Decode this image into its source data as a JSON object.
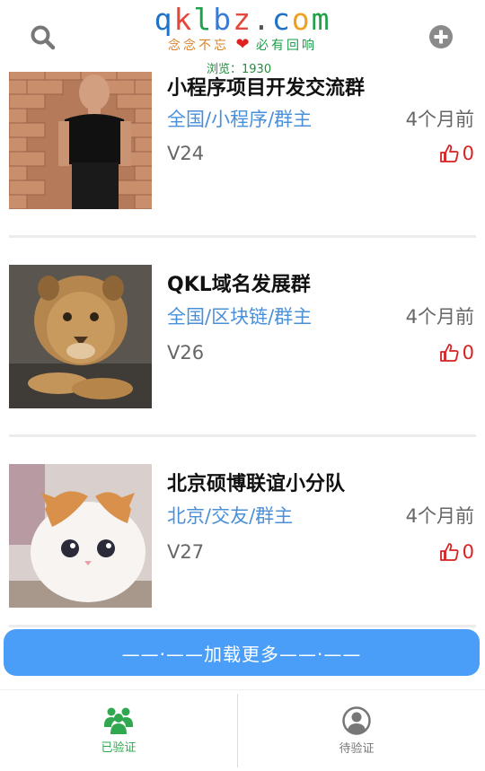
{
  "header": {
    "logo_letters": [
      "q",
      "k",
      "l",
      "b",
      "z",
      ".",
      "c",
      "o",
      "m"
    ],
    "logo_colors": [
      "#1e73c8",
      "#e5483a",
      "#21a04a",
      "#3a7bd5",
      "#e5483a",
      "#555555",
      "#1e73c8",
      "#f0a020",
      "#21a04a"
    ],
    "slogan_left": "念念不忘",
    "slogan_right": "必有回响",
    "views": "浏览：1930",
    "search_icon": "search-icon",
    "add_icon": "plus-circle-icon"
  },
  "items": [
    {
      "title": "小程序项目开发交流群",
      "tags": "全国/小程序/群主",
      "time": "4个月前",
      "version": "V24",
      "likes": "0",
      "image": "man-brick-wall-photo"
    },
    {
      "title": "QKL域名发展群",
      "tags": "全国/区块链/群主",
      "time": "4个月前",
      "version": "V26",
      "likes": "0",
      "image": "lion-cub-photo"
    },
    {
      "title": "北京硕博联谊小分队",
      "tags": "北京/交友/群主",
      "time": "4个月前",
      "version": "V27",
      "likes": "0",
      "image": "white-cat-photo"
    }
  ],
  "load_more": "——·——加载更多——·——",
  "tabbar": {
    "verified": "已验证",
    "pending": "待验证"
  },
  "colors": {
    "accent": "#4a9ef7",
    "tag": "#4a90d9",
    "like": "#d62222",
    "verified": "#2fa84f"
  }
}
